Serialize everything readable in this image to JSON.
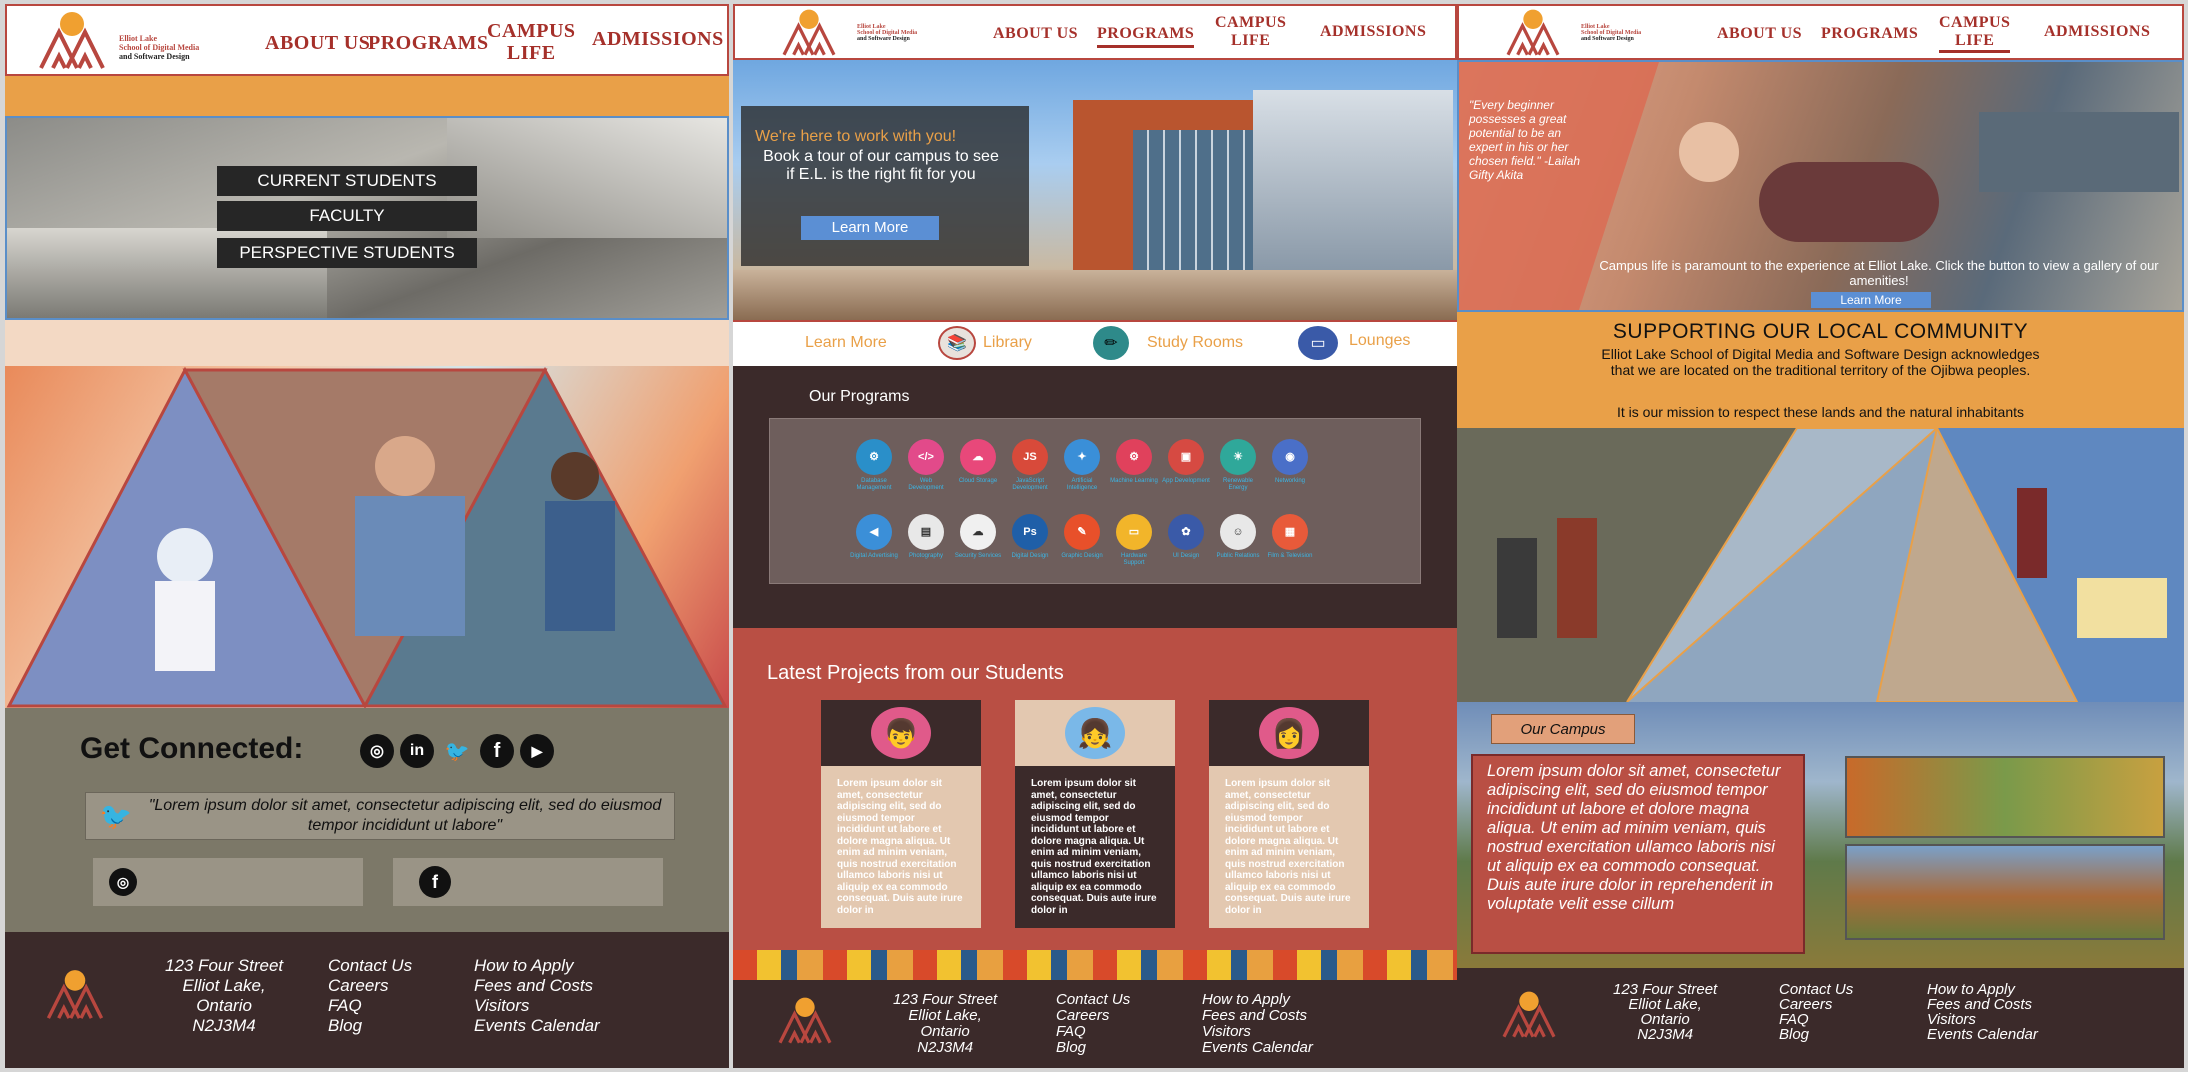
{
  "school": {
    "name_line1": "Elliot Lake",
    "name_line2": "School of Digital Media",
    "name_line3": "and Software Design"
  },
  "nav": {
    "about": "ABOUT US",
    "programs": "PROGRAMS",
    "campus_line1": "CAMPUS",
    "campus_line2": "LIFE",
    "admissions": "ADMISSIONS"
  },
  "panel1": {
    "audience_buttons": [
      "CURRENT STUDENTS",
      "FACULTY",
      "PERSPECTIVE STUDENTS"
    ],
    "connect_title": "Get Connected:",
    "social_icons": [
      "instagram-icon",
      "linkedin-icon",
      "twitter-icon",
      "facebook-icon",
      "youtube-icon"
    ],
    "tweet": "\"Lorem ipsum dolor sit amet, consectetur adipiscing elit, sed do eiusmod tempor incididunt ut labore\""
  },
  "panel2": {
    "hero_tagline": "We're here to work with you!",
    "hero_text": "Book a tour of our campus to see if E.L. is the right fit for you",
    "hero_button": "Learn More",
    "quick_links": [
      "Learn More",
      "Library",
      "Study Rooms",
      "Lounges"
    ],
    "programs_title": "Our Programs",
    "programs": [
      {
        "name": "Database Management",
        "color": "#2a8fc9",
        "glyph": "⚙"
      },
      {
        "name": "Web Development",
        "color": "#e24a8a",
        "glyph": "</>"
      },
      {
        "name": "Cloud Storage",
        "color": "#e8487a",
        "glyph": "☁"
      },
      {
        "name": "JavaScript Development",
        "color": "#d84a3a",
        "glyph": "JS"
      },
      {
        "name": "Artificial Intelligence",
        "color": "#3a8fd8",
        "glyph": "✦"
      },
      {
        "name": "Machine Learning",
        "color": "#e0415c",
        "glyph": "⚙"
      },
      {
        "name": "App Development",
        "color": "#d64a42",
        "glyph": "▣"
      },
      {
        "name": "Renewable Energy",
        "color": "#2fa89a",
        "glyph": "☀"
      },
      {
        "name": "Networking",
        "color": "#4a6fc8",
        "glyph": "◉"
      },
      {
        "name": "Digital Advertising",
        "color": "#3b8fd8",
        "glyph": "◀"
      },
      {
        "name": "Photography",
        "color": "#e8e8e8",
        "glyph": "▤"
      },
      {
        "name": "Security Services",
        "color": "#f0f0f0",
        "glyph": "☁"
      },
      {
        "name": "Digital Design",
        "color": "#1f5fa8",
        "glyph": "Ps"
      },
      {
        "name": "Graphic Design",
        "color": "#e8502a",
        "glyph": "✎"
      },
      {
        "name": "Hardware Support",
        "color": "#f2b52a",
        "glyph": "▭"
      },
      {
        "name": "UI Design",
        "color": "#3a5aa8",
        "glyph": "✿"
      },
      {
        "name": "Public Relations",
        "color": "#e8e8e8",
        "glyph": "☺"
      },
      {
        "name": "Film & Television",
        "color": "#e85a3a",
        "glyph": "▦"
      }
    ],
    "projects_title": "Latest Projects from our Students",
    "project_text": "Lorem ipsum dolor sit amet, consectetur adipiscing elit, sed do eiusmod tempor incididunt ut labore et dolore magna aliqua. Ut enim ad minim veniam, quis nostrud exercitation ullamco laboris nisi ut aliquip ex ea commodo consequat. Duis aute irure dolor in"
  },
  "panel3": {
    "quote": "\"Every beginner possesses a great potential to be an expert in his or her chosen field.\" -Lailah Gifty Akita",
    "campus_text": "Campus life is paramount to the experience at Elliot Lake. Click the button to view a gallery of our amenities!",
    "campus_button": "Learn More",
    "community_title": "SUPPORTING OUR LOCAL COMMUNITY",
    "community_text": "Elliot Lake School of Digital Media and Software Design acknowledges that we are located on the traditional territory of the Ojibwa peoples.",
    "community_mission": "It is our mission to respect these lands and the natural inhabitants",
    "our_campus_label": "Our Campus",
    "our_campus_text": "Lorem ipsum dolor sit amet, consectetur adipiscing elit, sed do eiusmod tempor incididunt ut labore et dolore magna aliqua. Ut enim ad minim veniam, quis nostrud exercitation ullamco laboris nisi ut aliquip ex ea commodo consequat. Duis aute irure dolor in reprehenderit in voluptate velit esse cillum"
  },
  "footer": {
    "address": [
      "123 Four Street",
      "Elliot Lake,",
      "Ontario",
      "N2J3M4"
    ],
    "links1": [
      "Contact Us",
      "Careers",
      "FAQ",
      "Blog"
    ],
    "links2": [
      "How to Apply",
      "Fees and Costs",
      "Visitors",
      "Events Calendar"
    ]
  },
  "colors": {
    "brand_red": "#a5302a",
    "orange": "#e9a048",
    "dark_brown": "#3b2a2a",
    "olive_gray": "#7c7868",
    "coral": "#b94f44"
  }
}
